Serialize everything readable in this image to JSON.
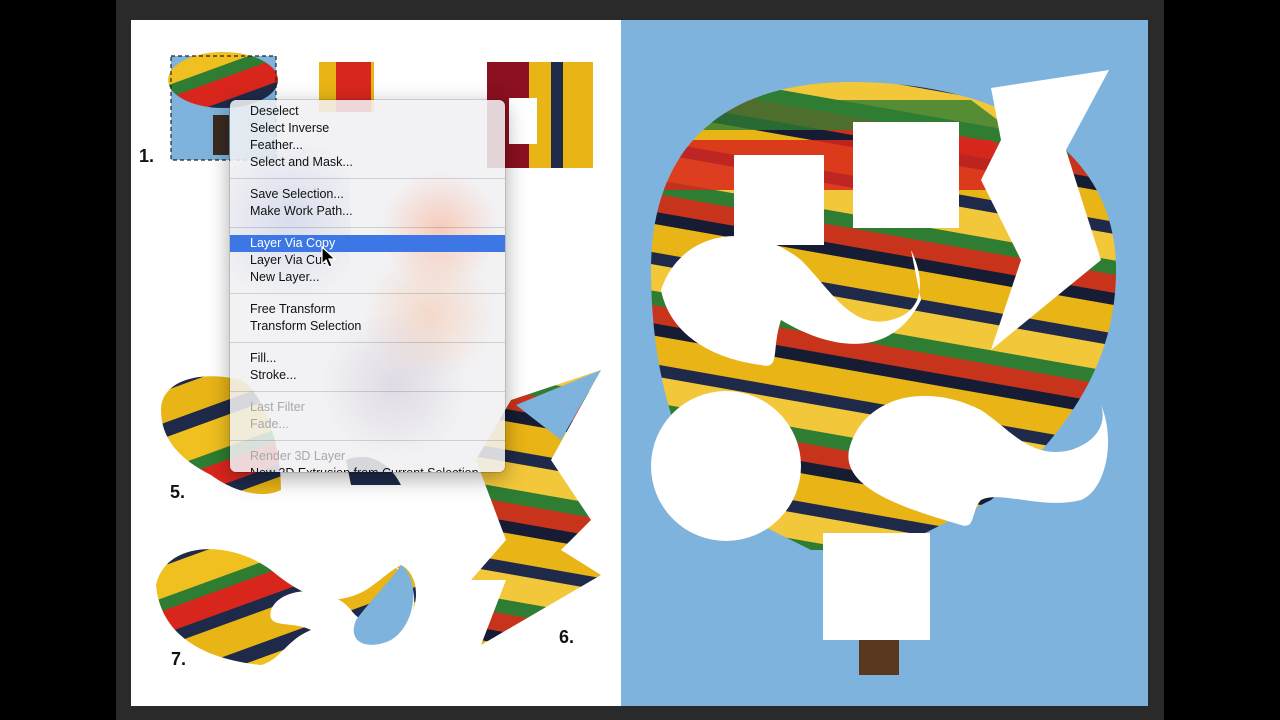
{
  "step_labels": {
    "one": "1.",
    "five": "5.",
    "six": "6.",
    "seven": "7."
  },
  "context_menu": {
    "groups": [
      [
        {
          "label": "Deselect",
          "enabled": true
        },
        {
          "label": "Select Inverse",
          "enabled": true
        },
        {
          "label": "Feather...",
          "enabled": true
        },
        {
          "label": "Select and Mask...",
          "enabled": true
        }
      ],
      [
        {
          "label": "Save Selection...",
          "enabled": true
        },
        {
          "label": "Make Work Path...",
          "enabled": true
        }
      ],
      [
        {
          "label": "Layer Via Copy",
          "enabled": true,
          "highlighted": true
        },
        {
          "label": "Layer Via Cut",
          "enabled": true
        },
        {
          "label": "New Layer...",
          "enabled": true
        }
      ],
      [
        {
          "label": "Free Transform",
          "enabled": true
        },
        {
          "label": "Transform Selection",
          "enabled": true
        }
      ],
      [
        {
          "label": "Fill...",
          "enabled": true
        },
        {
          "label": "Stroke...",
          "enabled": true
        }
      ],
      [
        {
          "label": "Last Filter",
          "enabled": false
        },
        {
          "label": "Fade...",
          "enabled": false
        }
      ],
      [
        {
          "label": "Render 3D Layer",
          "enabled": false
        },
        {
          "label": "New 3D Extrusion from Current Selection",
          "enabled": true
        }
      ]
    ]
  },
  "icons": {
    "cursor": "arrow-pointer-icon",
    "selection": "marching-ants-selection-icon"
  },
  "colors": {
    "sky": "#7db3dd",
    "balloon_yellow": "#e8b416",
    "balloon_red": "#d9261c",
    "balloon_darkred": "#8b1020",
    "balloon_navy": "#1f2a4a",
    "balloon_green": "#2e7d32",
    "menu_highlight": "#3d77e6"
  }
}
